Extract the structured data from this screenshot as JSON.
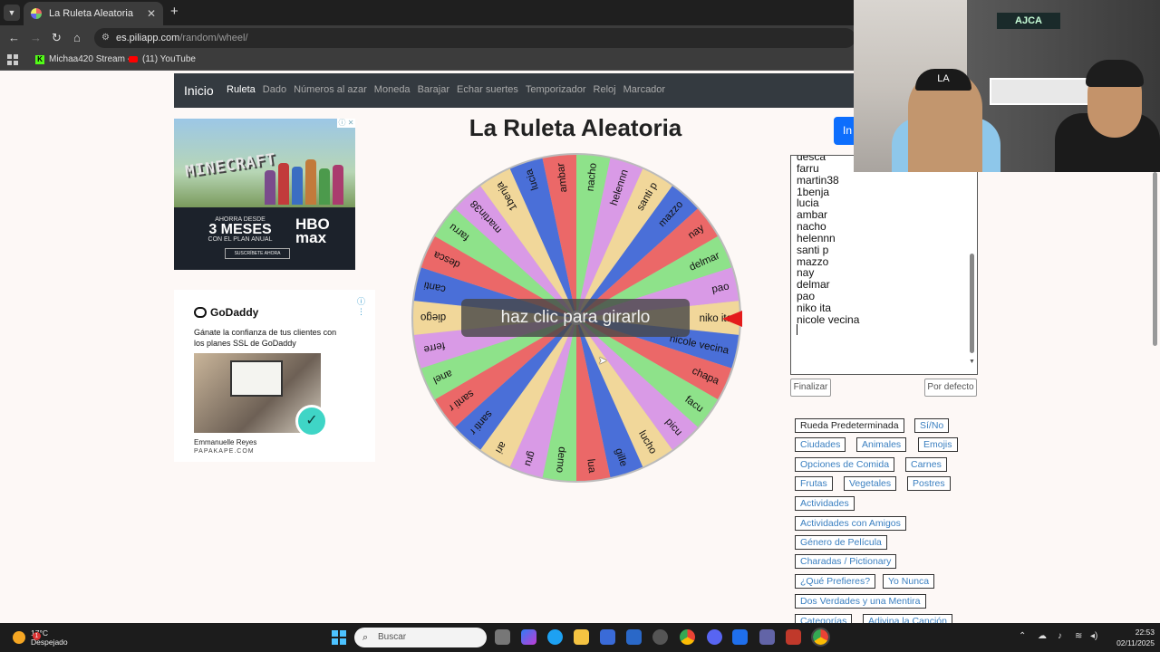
{
  "browser": {
    "tab_title": "La Ruleta Aleatoria",
    "url_host": "es.piliapp.com",
    "url_path": "/random/wheel/",
    "bookmarks": [
      "Michaa420 Stream -...",
      "(11) YouTube"
    ]
  },
  "site_nav": {
    "brand": "Inicio",
    "links": [
      "Ruleta",
      "Dado",
      "Números al azar",
      "Moneda",
      "Barajar",
      "Echar suertes",
      "Temporizador",
      "Reloj",
      "Marcador"
    ]
  },
  "ads": {
    "hbo": {
      "game": "MINECRAFT",
      "line1": "AHORRA DESDE",
      "line2": "3 MESES",
      "line3": "CON EL PLAN ANUAL",
      "brand": "HBO max",
      "cta": "SUSCRÍBETE AHORA"
    },
    "godaddy": {
      "brand": "GoDaddy",
      "text": "Gánate la confianza de tus clientes con los planes SSL de GoDaddy",
      "person": "Emmanuelle Reyes",
      "site": "PAPAKAPE.COM"
    }
  },
  "main": {
    "title": "La Ruleta Aleatoria",
    "spin_overlay": "haz clic para girarlo",
    "side_button": "In"
  },
  "names_text": [
    "desca",
    "farru",
    "martin38",
    "1benja",
    "lucia",
    "ambar",
    "nacho",
    "helennn",
    "santi p",
    "mazzo",
    "nay",
    "delmar",
    "pao",
    "niko ita",
    "nicole vecina"
  ],
  "wheel": {
    "labels": [
      "niko ita",
      "nicole vecina",
      "chapa",
      "facu",
      "picu",
      "lucho",
      "gille",
      "lua",
      "demo",
      "gru",
      "ari",
      "santi r",
      "santi r",
      "anel",
      "ferre",
      "diego",
      "canti",
      "desca",
      "farru",
      "martin38",
      "1benja",
      "lucia",
      "ambar",
      "nacho",
      "helennn",
      "santi p",
      "mazzo",
      "nay",
      "delmar",
      "pao"
    ],
    "colors": [
      "#f1d79a",
      "#4a6fd8",
      "#eb6868",
      "#8ee28a",
      "#d99ae6"
    ]
  },
  "buttons": {
    "finish": "Finalizar",
    "default": "Por defecto"
  },
  "presets": [
    "Rueda Predeterminada",
    "Sí/No",
    "Ciudades",
    "Animales",
    "Emojis",
    "Opciones de Comida",
    "Carnes",
    "Frutas",
    "Vegetales",
    "Postres",
    "Actividades",
    "Actividades con Amigos",
    "Género de Película",
    "Charadas / Pictionary",
    "¿Qué Prefieres?",
    "Yo Nunca",
    "Dos Verdades y una Mentira",
    "Categorías",
    "Adivina la Canción"
  ],
  "webcam": {
    "neon_sign": "AJCA",
    "cap_logo": "LA"
  },
  "taskbar": {
    "weather_temp": "17°C",
    "weather_desc": "Despejado",
    "weather_badge": "1",
    "search_placeholder": "Buscar",
    "time": "22:53",
    "date": "02/11/2025"
  }
}
